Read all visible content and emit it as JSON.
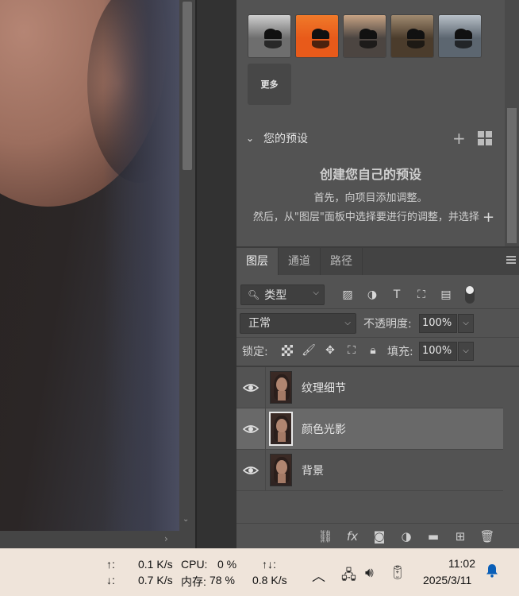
{
  "presets": {
    "thumbnails": [
      {
        "name": "preset-1",
        "sky": "#cfcfcf",
        "water": "#6e6e6e"
      },
      {
        "name": "preset-2",
        "sky": "#f07a2a",
        "water": "#e85a1a"
      },
      {
        "name": "preset-3",
        "sky": "#c7a384",
        "water": "#4c4541"
      },
      {
        "name": "preset-4",
        "sky": "#a08a70",
        "water": "#4b3c2c"
      },
      {
        "name": "preset-5",
        "sky": "#b8c0c8",
        "water": "#5c6670"
      }
    ],
    "more_label": "更多",
    "section_label": "您的预设",
    "create_title": "创建您自己的预设",
    "create_line1": "首先，向项目添加调整。",
    "create_line2": "然后，从\"图层\"面板中选择要进行的调整，并选择"
  },
  "tabs": [
    {
      "label": "图层",
      "active": true
    },
    {
      "label": "通道",
      "active": false
    },
    {
      "label": "路径",
      "active": false
    }
  ],
  "filter": {
    "kind_label": "类型",
    "icons": [
      "image-filter-icon",
      "adjustment-filter-icon",
      "text-filter-icon",
      "shape-filter-icon",
      "smart-object-filter-icon"
    ]
  },
  "blend": {
    "mode": "正常",
    "opacity_label": "不透明度:",
    "opacity_value": "100%",
    "lock_label": "锁定:",
    "fill_label": "填充:",
    "fill_value": "100%"
  },
  "layers": [
    {
      "name": "纹理细节",
      "selected": false
    },
    {
      "name": "颜色光影",
      "selected": true
    },
    {
      "name": "背景",
      "selected": false
    }
  ],
  "taskbar": {
    "up_arrow": "↑:",
    "down_arrow": "↓:",
    "up_speed": "0.1 K/s",
    "down_speed": "0.7 K/s",
    "cpu_label": "CPU:",
    "cpu_value": "0 %",
    "mem_label": "内存:",
    "mem_value": "78 %",
    "total_arrow": "↑↓:",
    "total_speed": "0.8 K/s",
    "time": "11:02",
    "date": "2025/3/11"
  }
}
